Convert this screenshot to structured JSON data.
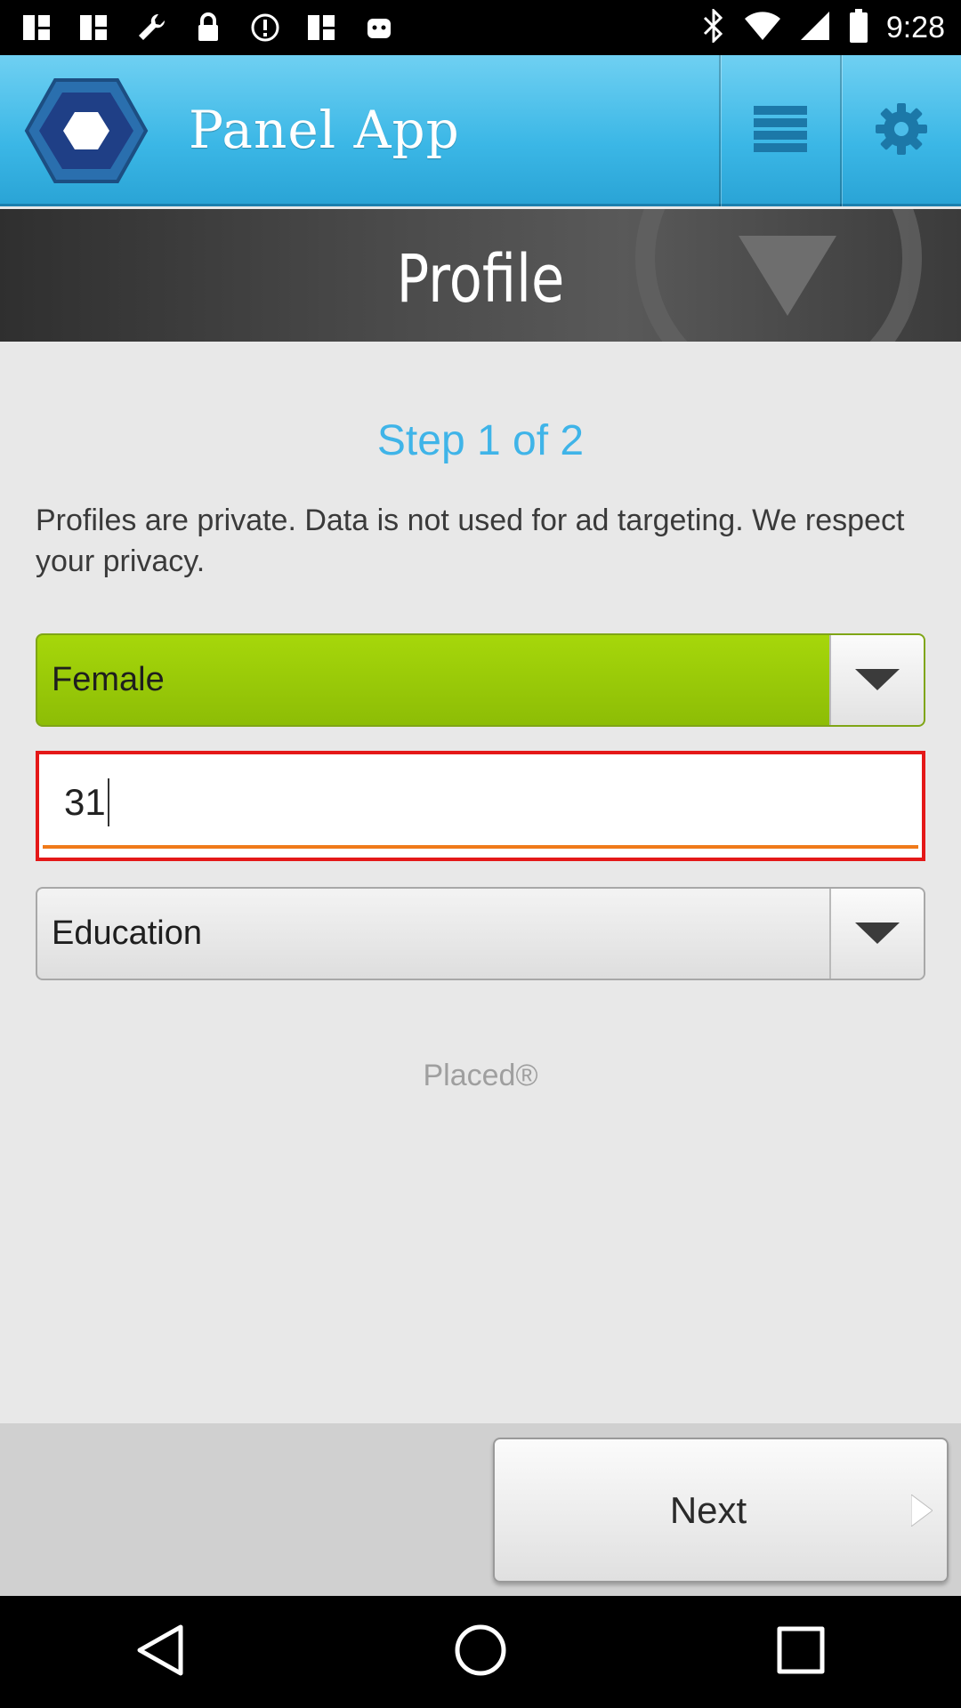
{
  "status_bar": {
    "time": "9:28",
    "icons": [
      "notification-icon",
      "notification-icon",
      "wrench-icon",
      "lock-icon",
      "alert-icon",
      "notification-icon",
      "android-icon",
      "bluetooth-icon",
      "wifi-icon",
      "signal-icon",
      "battery-icon"
    ]
  },
  "app_bar": {
    "title": "Panel App",
    "logo": "hexagon-logo",
    "menu_icon": "menu-icon",
    "settings_icon": "gear-icon",
    "background_color": "#3bb7e6"
  },
  "header": {
    "title": "Profile"
  },
  "form": {
    "step_label": "Step 1 of 2",
    "privacy_text": "Profiles are private. Data is not used for ad targeting. We respect your privacy.",
    "gender_value": "Female",
    "age_value": "31",
    "education_value": "Education"
  },
  "brand": "Placed®",
  "footer": {
    "next_label": "Next"
  },
  "colors": {
    "accent": "#3fb4e8",
    "selected_green": "#9acc07",
    "error_red": "#e41818",
    "focus_orange": "#f07a1a"
  },
  "nav_bar": {
    "back_icon": "back-icon",
    "home_icon": "home-icon",
    "recents_icon": "recents-icon"
  }
}
